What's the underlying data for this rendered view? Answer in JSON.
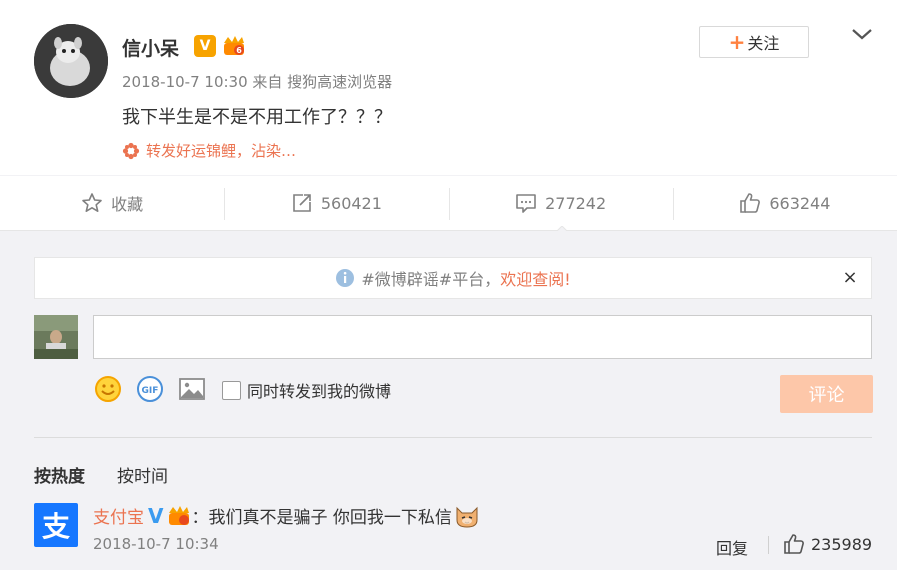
{
  "post": {
    "author": "信小呆",
    "verified_badge": "V",
    "level_badge_icon": "vip-crown-icon",
    "meta": "2018-10-7 10:30 来自 搜狗高速浏览器",
    "content": "我下半生是不是不用工作了？？？",
    "promo": "转发好运锦鲤，沾染…",
    "follow_label": "关注",
    "follow_plus": "+"
  },
  "actions": {
    "favorite": "收藏",
    "repost_count": "560421",
    "comment_count": "277242",
    "like_count": "663244"
  },
  "comments": {
    "notice_prefix": "#微博辟谣#平台，",
    "notice_link": "欢迎查阅!",
    "notice_close": "×",
    "input_placeholder": "",
    "repost_checkbox_label": "同时转发到我的微博",
    "submit_label": "评论",
    "sort_hot": "按热度",
    "sort_time": "按时间",
    "items": [
      {
        "user": "支付宝",
        "verified": "V",
        "avatar_glyph": "支",
        "text": "：我们真不是骗子 你回我一下私信",
        "time": "2018-10-7 10:34",
        "reply_label": "回复",
        "likes": "235989"
      }
    ]
  },
  "colors": {
    "accent": "#eb7350",
    "follow_plus": "#ff8140",
    "submit_disabled": "#fdc7a9",
    "comment_bg": "#f2f2f5",
    "alipay_blue": "#1677ff",
    "verified_blue": "#3a9bf0",
    "vbadge_orange": "#f7a300"
  }
}
